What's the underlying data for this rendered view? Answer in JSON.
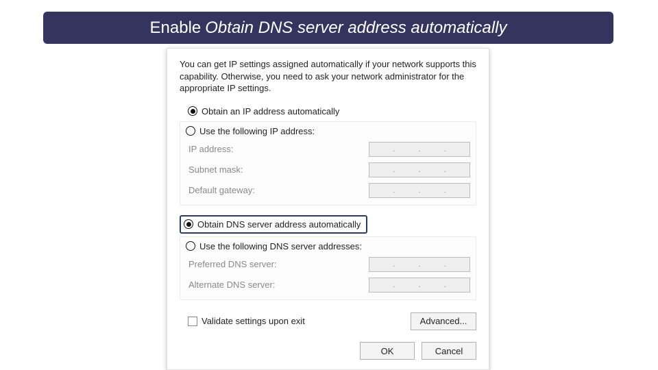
{
  "instruction": {
    "prefix": "Enable",
    "target": "Obtain DNS server address automatically"
  },
  "dialog": {
    "intro": "You can get IP settings assigned automatically if your network supports this capability. Otherwise, you need to ask your network administrator for the appropriate IP settings.",
    "ip": {
      "auto_label": "Obtain an IP address automatically",
      "manual_label": "Use the following IP address:",
      "auto_selected": true,
      "fields": {
        "ip_address": "IP address:",
        "subnet_mask": "Subnet mask:",
        "default_gateway": "Default gateway:"
      }
    },
    "dns": {
      "auto_label": "Obtain DNS server address automatically",
      "manual_label": "Use the following DNS server addresses:",
      "auto_selected": true,
      "focused": true,
      "fields": {
        "preferred": "Preferred DNS server:",
        "alternate": "Alternate DNS server:"
      }
    },
    "validate_label": "Validate settings upon exit",
    "buttons": {
      "advanced": "Advanced...",
      "ok": "OK",
      "cancel": "Cancel"
    },
    "ip_dots": ". . ."
  }
}
